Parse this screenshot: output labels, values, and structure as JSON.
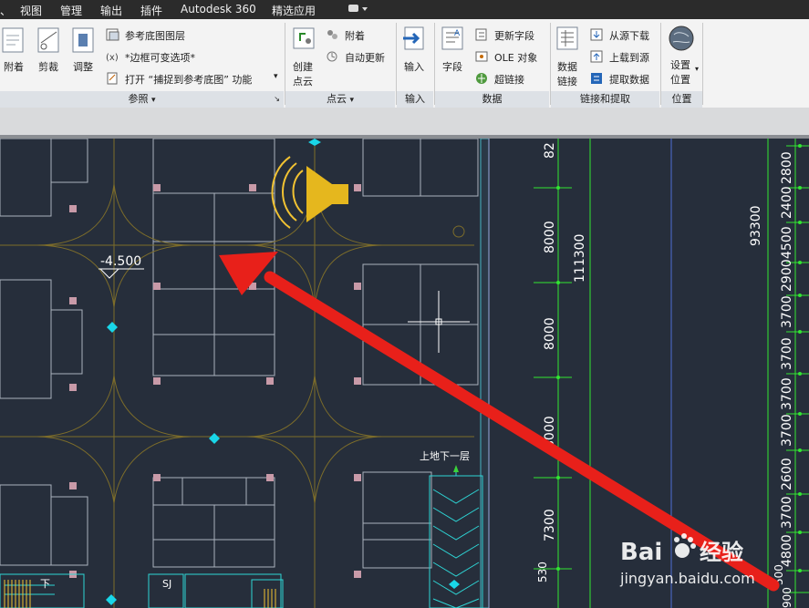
{
  "menubar": {
    "items": [
      "视图",
      "管理",
      "输出",
      "插件",
      "Autodesk 360",
      "精选应用"
    ],
    "partial_left": "、"
  },
  "ribbon": {
    "panels": {
      "reference": {
        "title": "参照",
        "buttons": {
          "attach": "附着",
          "clip": "剪裁",
          "adjust": "调整"
        },
        "rows": [
          "参考底图图层",
          "*边框可变选项*",
          "打开 “捕捉到参考底图” 功能"
        ]
      },
      "pointcloud": {
        "title": "点云",
        "button": [
          "创建",
          "点云"
        ],
        "rows": [
          "附着",
          "自动更新"
        ]
      },
      "import": {
        "title": "输入",
        "button": "输入"
      },
      "data": {
        "title": "数据",
        "button": "字段",
        "rows": [
          "更新字段",
          "OLE 对象",
          "超链接"
        ]
      },
      "linking": {
        "title": "链接和提取",
        "button": [
          "数据",
          "链接"
        ],
        "rows": [
          "从源下载",
          "上载到源",
          "提取数据"
        ]
      },
      "location": {
        "title": "位置",
        "button": [
          "设置",
          "位置"
        ]
      }
    }
  },
  "drawing": {
    "level_label": "-4.500",
    "stair_label": "上地下一层",
    "room_label": "下",
    "sj_label": "SJ",
    "dims_col1": [
      "82",
      "8000",
      "8000",
      "8000",
      "7300",
      "530"
    ],
    "dims_col2": [
      "111300"
    ],
    "dims_col3": [
      "93300"
    ],
    "dims_col4": [
      "2800",
      "2400",
      "4500",
      "2900",
      "3700",
      "3700",
      "3700",
      "3700",
      "2600",
      "3700",
      "4800",
      "500",
      "900"
    ]
  },
  "watermark": {
    "brand": "Bai",
    "brand2": "经验",
    "url": "jingyan.baidu.com"
  }
}
